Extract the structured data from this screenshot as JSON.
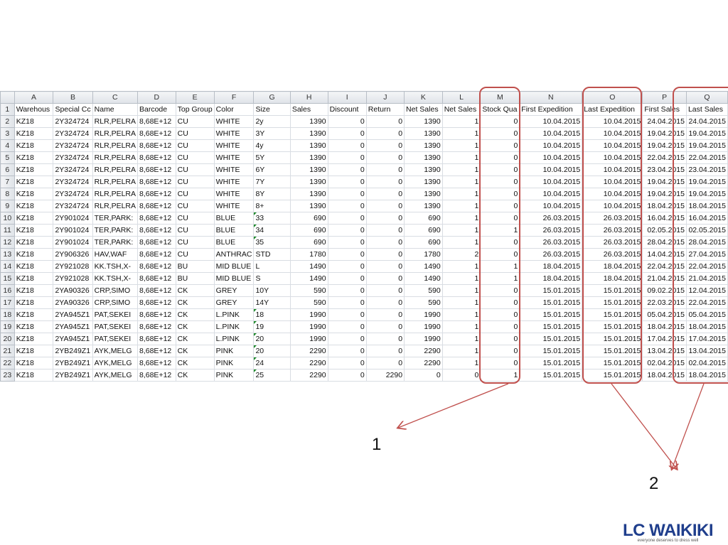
{
  "columns": [
    "A",
    "B",
    "C",
    "D",
    "E",
    "F",
    "G",
    "H",
    "I",
    "J",
    "K",
    "L",
    "M",
    "N",
    "O",
    "P",
    "Q"
  ],
  "headers": [
    "Warehous",
    "Special Cc",
    "Name",
    "Barcode",
    "Top Group",
    "Color",
    "Size",
    "Sales",
    "Discount",
    "Return",
    "Net Sales",
    "Net Sales",
    "Stock Qua",
    "First Expedition",
    "Last Expedition",
    "First Sales",
    "Last Sales"
  ],
  "rows": [
    [
      "KZ18",
      "2Y324724",
      "RLR,PELRA",
      "8,68E+12",
      "CU",
      "WHITE",
      "2y",
      "1390",
      "0",
      "0",
      "1390",
      "1",
      "0",
      "10.04.2015",
      "10.04.2015",
      "24.04.2015",
      "24.04.2015"
    ],
    [
      "KZ18",
      "2Y324724",
      "RLR,PELRA",
      "8,68E+12",
      "CU",
      "WHITE",
      "3Y",
      "1390",
      "0",
      "0",
      "1390",
      "1",
      "0",
      "10.04.2015",
      "10.04.2015",
      "19.04.2015",
      "19.04.2015"
    ],
    [
      "KZ18",
      "2Y324724",
      "RLR,PELRA",
      "8,68E+12",
      "CU",
      "WHITE",
      "4y",
      "1390",
      "0",
      "0",
      "1390",
      "1",
      "0",
      "10.04.2015",
      "10.04.2015",
      "19.04.2015",
      "19.04.2015"
    ],
    [
      "KZ18",
      "2Y324724",
      "RLR,PELRA",
      "8,68E+12",
      "CU",
      "WHITE",
      "5Y",
      "1390",
      "0",
      "0",
      "1390",
      "1",
      "0",
      "10.04.2015",
      "10.04.2015",
      "22.04.2015",
      "22.04.2015"
    ],
    [
      "KZ18",
      "2Y324724",
      "RLR,PELRA",
      "8,68E+12",
      "CU",
      "WHITE",
      "6Y",
      "1390",
      "0",
      "0",
      "1390",
      "1",
      "0",
      "10.04.2015",
      "10.04.2015",
      "23.04.2015",
      "23.04.2015"
    ],
    [
      "KZ18",
      "2Y324724",
      "RLR,PELRA",
      "8,68E+12",
      "CU",
      "WHITE",
      "7Y",
      "1390",
      "0",
      "0",
      "1390",
      "1",
      "0",
      "10.04.2015",
      "10.04.2015",
      "19.04.2015",
      "19.04.2015"
    ],
    [
      "KZ18",
      "2Y324724",
      "RLR,PELRA",
      "8,68E+12",
      "CU",
      "WHITE",
      "8Y",
      "1390",
      "0",
      "0",
      "1390",
      "1",
      "0",
      "10.04.2015",
      "10.04.2015",
      "19.04.2015",
      "19.04.2015"
    ],
    [
      "KZ18",
      "2Y324724",
      "RLR,PELRA",
      "8,68E+12",
      "CU",
      "WHITE",
      "8+",
      "1390",
      "0",
      "0",
      "1390",
      "1",
      "0",
      "10.04.2015",
      "10.04.2015",
      "18.04.2015",
      "18.04.2015"
    ],
    [
      "KZ18",
      "2Y901024",
      "TER,PARK:",
      "8,68E+12",
      "CU",
      "BLUE",
      "33",
      "690",
      "0",
      "0",
      "690",
      "1",
      "0",
      "26.03.2015",
      "26.03.2015",
      "16.04.2015",
      "16.04.2015"
    ],
    [
      "KZ18",
      "2Y901024",
      "TER,PARK:",
      "8,68E+12",
      "CU",
      "BLUE",
      "34",
      "690",
      "0",
      "0",
      "690",
      "1",
      "1",
      "26.03.2015",
      "26.03.2015",
      "02.05.2015",
      "02.05.2015"
    ],
    [
      "KZ18",
      "2Y901024",
      "TER,PARK:",
      "8,68E+12",
      "CU",
      "BLUE",
      "35",
      "690",
      "0",
      "0",
      "690",
      "1",
      "0",
      "26.03.2015",
      "26.03.2015",
      "28.04.2015",
      "28.04.2015"
    ],
    [
      "KZ18",
      "2Y906326",
      "HAV,WAF",
      "8,68E+12",
      "CU",
      "ANTHRAC",
      "STD",
      "1780",
      "0",
      "0",
      "1780",
      "2",
      "0",
      "26.03.2015",
      "26.03.2015",
      "14.04.2015",
      "27.04.2015"
    ],
    [
      "KZ18",
      "2Y921028",
      "KK.TSH,X-",
      "8,68E+12",
      "BU",
      "MID BLUE",
      "L",
      "1490",
      "0",
      "0",
      "1490",
      "1",
      "1",
      "18.04.2015",
      "18.04.2015",
      "22.04.2015",
      "22.04.2015"
    ],
    [
      "KZ18",
      "2Y921028",
      "KK.TSH,X-",
      "8,68E+12",
      "BU",
      "MID BLUE",
      "S",
      "1490",
      "0",
      "0",
      "1490",
      "1",
      "1",
      "18.04.2015",
      "18.04.2015",
      "21.04.2015",
      "21.04.2015"
    ],
    [
      "KZ18",
      "2YA90326",
      "CRP,SIMO",
      "8,68E+12",
      "CK",
      "GREY",
      "10Y",
      "590",
      "0",
      "0",
      "590",
      "1",
      "0",
      "15.01.2015",
      "15.01.2015",
      "09.02.2015",
      "12.04.2015"
    ],
    [
      "KZ18",
      "2YA90326",
      "CRP,SIMO",
      "8,68E+12",
      "CK",
      "GREY",
      "14Y",
      "590",
      "0",
      "0",
      "590",
      "1",
      "0",
      "15.01.2015",
      "15.01.2015",
      "22.03.2015",
      "22.04.2015"
    ],
    [
      "KZ18",
      "2YA945Z1",
      "PAT,SEKEI",
      "8,68E+12",
      "CK",
      "L.PINK",
      "18",
      "1990",
      "0",
      "0",
      "1990",
      "1",
      "0",
      "15.01.2015",
      "15.01.2015",
      "05.04.2015",
      "05.04.2015"
    ],
    [
      "KZ18",
      "2YA945Z1",
      "PAT,SEKEI",
      "8,68E+12",
      "CK",
      "L.PINK",
      "19",
      "1990",
      "0",
      "0",
      "1990",
      "1",
      "0",
      "15.01.2015",
      "15.01.2015",
      "18.04.2015",
      "18.04.2015"
    ],
    [
      "KZ18",
      "2YA945Z1",
      "PAT,SEKEI",
      "8,68E+12",
      "CK",
      "L.PINK",
      "20",
      "1990",
      "0",
      "0",
      "1990",
      "1",
      "0",
      "15.01.2015",
      "15.01.2015",
      "17.04.2015",
      "17.04.2015"
    ],
    [
      "KZ18",
      "2YB249Z1",
      "AYK,MELG",
      "8,68E+12",
      "CK",
      "PINK",
      "20",
      "2290",
      "0",
      "0",
      "2290",
      "1",
      "0",
      "15.01.2015",
      "15.01.2015",
      "13.04.2015",
      "13.04.2015"
    ],
    [
      "KZ18",
      "2YB249Z1",
      "AYK,MELG",
      "8,68E+12",
      "CK",
      "PINK",
      "24",
      "2290",
      "0",
      "0",
      "2290",
      "1",
      "0",
      "15.01.2015",
      "15.01.2015",
      "02.04.2015",
      "02.04.2015"
    ],
    [
      "KZ18",
      "2YB249Z1",
      "AYK,MELG",
      "8,68E+12",
      "CK",
      "PINK",
      "25",
      "2290",
      "0",
      "2290",
      "0",
      "0",
      "1",
      "15.01.2015",
      "15.01.2015",
      "18.04.2015",
      "18.04.2015"
    ]
  ],
  "annotations": {
    "label1": "1",
    "label2": "2",
    "highlight_color": "#c0504d"
  },
  "logo": {
    "name": "LC WAIKIKI",
    "tagline": "everyone deserves to dress well"
  }
}
